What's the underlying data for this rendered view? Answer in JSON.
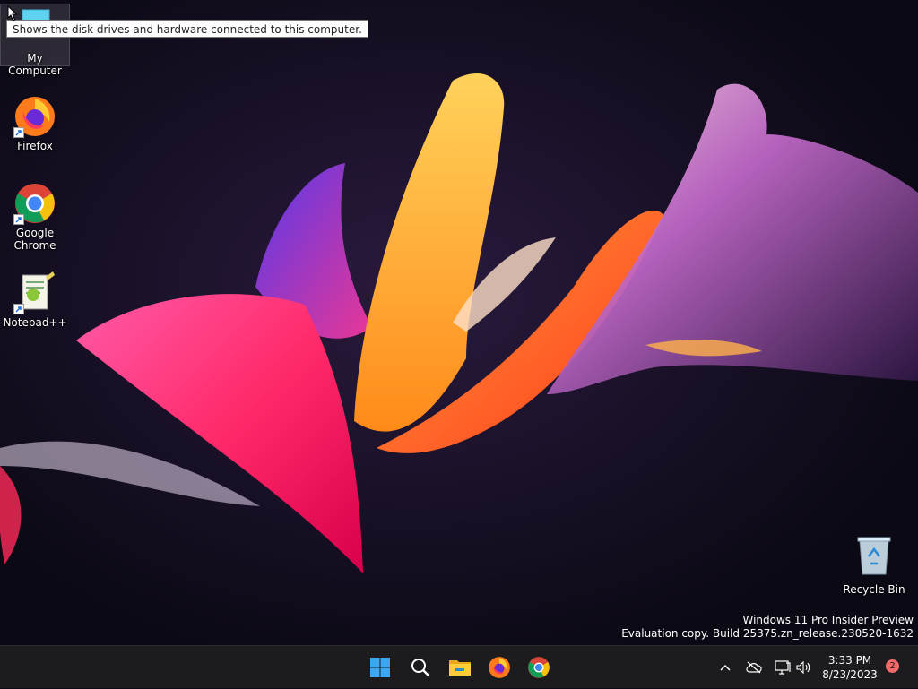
{
  "desktop": {
    "icons": [
      {
        "label": "My Computer",
        "icon": "computer-icon"
      },
      {
        "label": "Firefox",
        "icon": "firefox-icon"
      },
      {
        "label": "Google Chrome",
        "icon": "chrome-icon"
      },
      {
        "label": "Notepad++",
        "icon": "notepadpp-icon"
      },
      {
        "label": "Recycle Bin",
        "icon": "recycle-bin-icon"
      }
    ],
    "tooltip": "Shows the disk drives and hardware connected to this computer."
  },
  "watermark": {
    "line1": "Windows 11 Pro Insider Preview",
    "line2": "Evaluation copy. Build 25375.zn_release.230520-1632"
  },
  "taskbar": {
    "apps": [
      "start-icon",
      "search-icon",
      "file-explorer-icon",
      "firefox-icon",
      "chrome-icon"
    ],
    "tray": [
      "chevron-up-icon",
      "cloud-offline-icon",
      "network-icon",
      "volume-icon"
    ],
    "time": "3:33 PM",
    "date": "8/23/2023",
    "notification_count": "2"
  },
  "colors": {
    "taskbar_bg": "#1c1c1e",
    "desktop_bg": "#0d0a18",
    "accent_blue": "#3aa7f0"
  }
}
